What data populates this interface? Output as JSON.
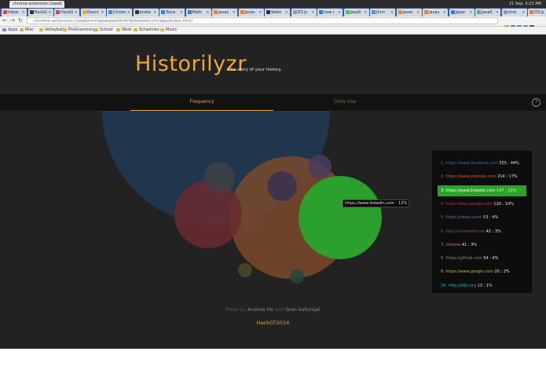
{
  "os": {
    "active_tab": "chrome-extension://aeeb",
    "time": "21 Sep, 5:23 AM"
  },
  "browser": {
    "tabs": [
      {
        "label": "Inbox",
        "color": "#d44638"
      },
      {
        "label": "HackG",
        "color": "#333333"
      },
      {
        "label": "HackG",
        "color": "#d44638"
      },
      {
        "label": "Overv",
        "color": "#f5a623"
      },
      {
        "label": "Chrom",
        "color": "#4a90d9"
      },
      {
        "label": "andre",
        "color": "#333333"
      },
      {
        "label": "Tools",
        "color": "#3b78d8"
      },
      {
        "label": "Math",
        "color": "#3b78d8"
      },
      {
        "label": "javas",
        "color": "#f48024"
      },
      {
        "label": "javas",
        "color": "#f48024"
      },
      {
        "label": "Selec",
        "color": "#333333"
      },
      {
        "label": "D3.js",
        "color": "#999999"
      },
      {
        "label": "how i",
        "color": "#3b78d8"
      },
      {
        "label": "JavaS",
        "color": "#5cb85c"
      },
      {
        "label": "Jhnn",
        "color": "#4a90d9"
      },
      {
        "label": "javas",
        "color": "#f48024"
      },
      {
        "label": "javas",
        "color": "#f48024"
      },
      {
        "label": "jquer",
        "color": "#3b78d8"
      },
      {
        "label": "JavaS",
        "color": "#5cb85c"
      },
      {
        "label": "chro",
        "color": "#999999"
      },
      {
        "label": "D3.js",
        "color": "#f48024"
      }
    ],
    "url": "chrome-extension://aeebmnmgpaeppkkhhhfgllooioehccfc/app/index.html",
    "bookmarks": [
      "Apps",
      "Misc",
      "Volleyball",
      "ProGramming",
      "School",
      "Work",
      "Schedules",
      "Music"
    ]
  },
  "app": {
    "title": "Historilyzr",
    "subtitle": "The story of your history.",
    "tabs": {
      "frequency": "Frequency",
      "daily_use": "Daily Use"
    },
    "help": "?",
    "tooltip": "https://www.linkedin.com - 12%",
    "sites": [
      {
        "rank": "1.",
        "url": "https://www.facebook.com",
        "stat": "555 : 44%",
        "color": "#3b6fb6"
      },
      {
        "rank": "2.",
        "url": "https://www.youtube.com",
        "stat": "214 : 17%",
        "color": "#e0552a"
      },
      {
        "rank": "3.",
        "url": "https://www.linkedin.com",
        "stat": "147 : 12%",
        "color": "#ffffff"
      },
      {
        "rank": "4.",
        "url": "https://mail.google.com",
        "stat": "120 : 10%",
        "color": "#c0392b"
      },
      {
        "rank": "5.",
        "url": "https://news.ycom",
        "stat": "53 : 4%",
        "color": "#7b6bb5"
      },
      {
        "rank": "6.",
        "url": "http://andrewhe.me",
        "stat": "42 : 3%",
        "color": "#8b5a3c"
      },
      {
        "rank": "7.",
        "url": "chrome",
        "stat": "41 : 3%",
        "color": "#d970c0"
      },
      {
        "rank": "8.",
        "url": "https://github.com",
        "stat": "54 : 4%",
        "color": "#888888"
      },
      {
        "rank": "9.",
        "url": "https://www.google.com",
        "stat": "20 : 2%",
        "color": "#b8b82a"
      },
      {
        "rank": "10.",
        "url": "http://d3js.org",
        "stat": "13 : 1%",
        "color": "#2ab3c8"
      }
    ],
    "bubbles": [
      {
        "name": "facebook",
        "color": "#1f3a55"
      },
      {
        "name": "youtube",
        "color": "#7a4a2a"
      },
      {
        "name": "linkedin",
        "color": "#2ca02c"
      },
      {
        "name": "mail-google",
        "color": "#6b2a30"
      },
      {
        "name": "github",
        "color": "#3f3f45"
      },
      {
        "name": "news-ycom",
        "color": "#3a3050"
      },
      {
        "name": "chrome",
        "color": "#4a3b5e"
      },
      {
        "name": "andrewhe",
        "color": "#6e4530"
      },
      {
        "name": "google",
        "color": "#4a4a26"
      },
      {
        "name": "d3js",
        "color": "#264440"
      }
    ]
  },
  "footer": {
    "made_by": "Made by",
    "author1": "Andrew He",
    "and": "and",
    "author2": "Sean Kallungal",
    "event": "HackGT2014"
  }
}
